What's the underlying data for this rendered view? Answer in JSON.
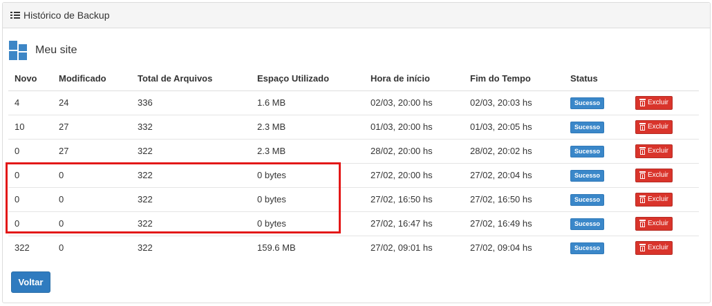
{
  "panel": {
    "title": "Histórico de Backup"
  },
  "site": {
    "name": "Meu site"
  },
  "table": {
    "headers": [
      "Novo",
      "Modificado",
      "Total de Arquivos",
      "Espaço Utilizado",
      "Hora de início",
      "Fim do Tempo",
      "Status",
      ""
    ],
    "rows": [
      {
        "novo": "4",
        "modificado": "24",
        "total": "336",
        "espaco": "1.6 MB",
        "inicio": "02/03, 20:00 hs",
        "fim": "02/03, 20:03 hs",
        "status": "Sucesso",
        "action": "Excluir"
      },
      {
        "novo": "10",
        "modificado": "27",
        "total": "332",
        "espaco": "2.3 MB",
        "inicio": "01/03, 20:00 hs",
        "fim": "01/03, 20:05 hs",
        "status": "Sucesso",
        "action": "Excluir"
      },
      {
        "novo": "0",
        "modificado": "27",
        "total": "322",
        "espaco": "2.3 MB",
        "inicio": "28/02, 20:00 hs",
        "fim": "28/02, 20:02 hs",
        "status": "Sucesso",
        "action": "Excluir"
      },
      {
        "novo": "0",
        "modificado": "0",
        "total": "322",
        "espaco": "0 bytes",
        "inicio": "27/02, 20:00 hs",
        "fim": "27/02, 20:04 hs",
        "status": "Sucesso",
        "action": "Excluir"
      },
      {
        "novo": "0",
        "modificado": "0",
        "total": "322",
        "espaco": "0 bytes",
        "inicio": "27/02, 16:50 hs",
        "fim": "27/02, 16:50 hs",
        "status": "Sucesso",
        "action": "Excluir"
      },
      {
        "novo": "0",
        "modificado": "0",
        "total": "322",
        "espaco": "0 bytes",
        "inicio": "27/02, 16:47 hs",
        "fim": "27/02, 16:49 hs",
        "status": "Sucesso",
        "action": "Excluir"
      },
      {
        "novo": "322",
        "modificado": "0",
        "total": "322",
        "espaco": "159.6 MB",
        "inicio": "27/02, 09:01 hs",
        "fim": "27/02, 09:04 hs",
        "status": "Sucesso",
        "action": "Excluir"
      }
    ]
  },
  "footer": {
    "back_label": "Voltar"
  },
  "icons": {
    "heading": "list-icon",
    "site": "blocks-icon",
    "delete": "trash-icon"
  },
  "colors": {
    "primary": "#2f7bbf",
    "danger": "#d9342b",
    "success_badge": "#3a87c9",
    "highlight": "#e31818"
  }
}
